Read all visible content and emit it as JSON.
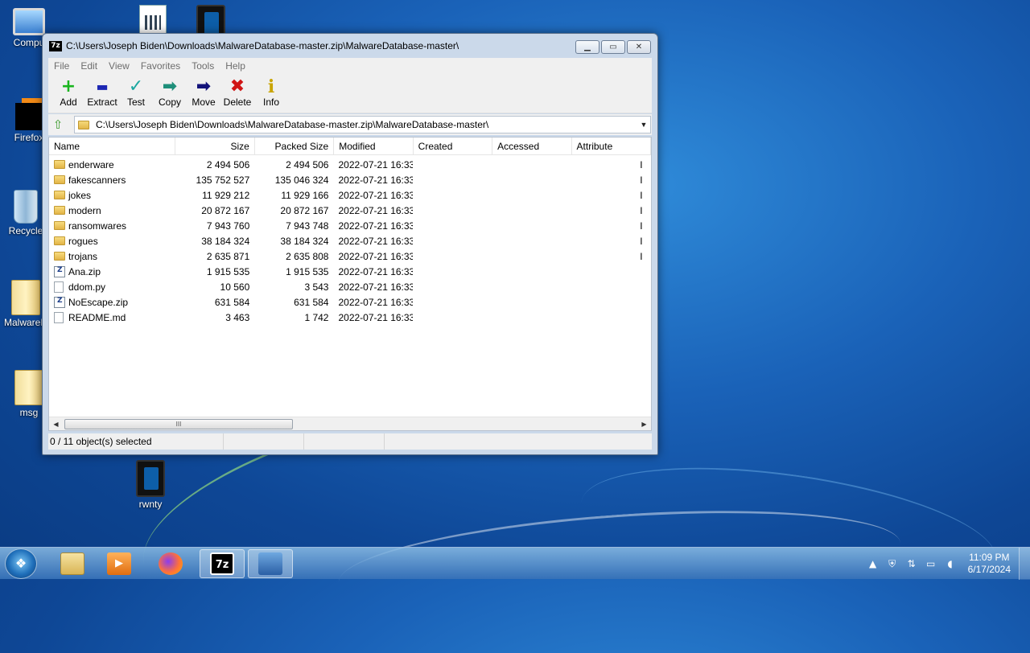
{
  "desktop": {
    "icons": [
      {
        "label": "Compu"
      },
      {
        "label": "Firefox"
      },
      {
        "label": "Recycle"
      },
      {
        "label": "MalwareD"
      },
      {
        "label": "msg"
      },
      {
        "label": "rwnty"
      }
    ]
  },
  "window": {
    "app_icon": "7z",
    "title": "C:\\Users\\Joseph Biden\\Downloads\\MalwareDatabase-master.zip\\MalwareDatabase-master\\",
    "controls": {
      "minimize": "minimize-icon",
      "maximize": "maximize-icon",
      "close": "close-icon"
    }
  },
  "menu": [
    "File",
    "Edit",
    "View",
    "Favorites",
    "Tools",
    "Help"
  ],
  "toolbar": [
    {
      "label": "Add",
      "icon": "plus-icon",
      "glyph": "+",
      "color": "#19b51e"
    },
    {
      "label": "Extract",
      "icon": "minus-icon",
      "glyph": "▬",
      "color": "#1d27b3"
    },
    {
      "label": "Test",
      "icon": "check-icon",
      "glyph": "✓",
      "color": "#1aa7a0"
    },
    {
      "label": "Copy",
      "icon": "arrow-right-icon",
      "glyph": "➡",
      "color": "#1f8f7a"
    },
    {
      "label": "Move",
      "icon": "arrow-right-icon",
      "glyph": "➡",
      "color": "#13137a"
    },
    {
      "label": "Delete",
      "icon": "x-icon",
      "glyph": "✖",
      "color": "#d01515"
    },
    {
      "label": "Info",
      "icon": "info-icon",
      "glyph": "i",
      "color": "#c9a400"
    }
  ],
  "address": {
    "path": "C:\\Users\\Joseph Biden\\Downloads\\MalwareDatabase-master.zip\\MalwareDatabase-master\\"
  },
  "columns": {
    "name": "Name",
    "size": "Size",
    "packed": "Packed Size",
    "modified": "Modified",
    "created": "Created",
    "accessed": "Accessed",
    "attributes": "Attribute"
  },
  "files": [
    {
      "name": "enderware",
      "type": "folder",
      "size": "2 494 506",
      "packed": "2 494 506",
      "modified": "2022-07-21 16:33",
      "attr": "I"
    },
    {
      "name": "fakescanners",
      "type": "folder",
      "size": "135 752 527",
      "packed": "135 046 324",
      "modified": "2022-07-21 16:33",
      "attr": "I"
    },
    {
      "name": "jokes",
      "type": "folder",
      "size": "11 929 212",
      "packed": "11 929 166",
      "modified": "2022-07-21 16:33",
      "attr": "I"
    },
    {
      "name": "modern",
      "type": "folder",
      "size": "20 872 167",
      "packed": "20 872 167",
      "modified": "2022-07-21 16:33",
      "attr": "I"
    },
    {
      "name": "ransomwares",
      "type": "folder",
      "size": "7 943 760",
      "packed": "7 943 748",
      "modified": "2022-07-21 16:33",
      "attr": "I"
    },
    {
      "name": "rogues",
      "type": "folder",
      "size": "38 184 324",
      "packed": "38 184 324",
      "modified": "2022-07-21 16:33",
      "attr": "I"
    },
    {
      "name": "trojans",
      "type": "folder",
      "size": "2 635 871",
      "packed": "2 635 808",
      "modified": "2022-07-21 16:33",
      "attr": "I"
    },
    {
      "name": "Ana.zip",
      "type": "zip",
      "size": "1 915 535",
      "packed": "1 915 535",
      "modified": "2022-07-21 16:33",
      "attr": ""
    },
    {
      "name": "ddom.py",
      "type": "file",
      "size": "10 560",
      "packed": "3 543",
      "modified": "2022-07-21 16:33",
      "attr": ""
    },
    {
      "name": "NoEscape.zip",
      "type": "zip",
      "size": "631 584",
      "packed": "631 584",
      "modified": "2022-07-21 16:33",
      "attr": ""
    },
    {
      "name": "README.md",
      "type": "file",
      "size": "3 463",
      "packed": "1 742",
      "modified": "2022-07-21 16:33",
      "attr": ""
    }
  ],
  "scrollbar": {
    "thumb_grip": "III"
  },
  "status": {
    "selection": "0 / 11 object(s) selected"
  },
  "taskbar": {
    "apps": [
      {
        "name": "explorer",
        "icon": "folder-icon"
      },
      {
        "name": "media-player",
        "icon": "media-player-icon"
      },
      {
        "name": "firefox",
        "icon": "firefox-icon"
      },
      {
        "name": "7zip",
        "icon": "7zip-icon",
        "glyph": "7z",
        "active": true
      },
      {
        "name": "network-app",
        "icon": "network-icon",
        "active": true
      }
    ],
    "tray_icons": [
      "show-hidden-icon",
      "shield-icon",
      "network-share-icon",
      "monitor-icon",
      "speaker-icon"
    ],
    "time": "11:09 PM",
    "date": "6/17/2024"
  }
}
